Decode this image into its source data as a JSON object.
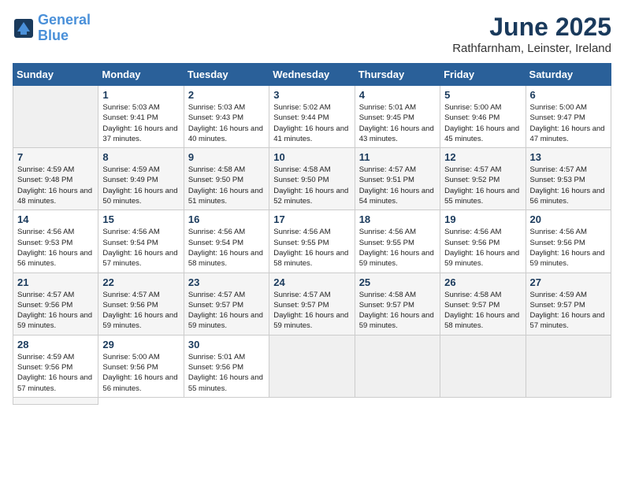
{
  "header": {
    "logo_line1": "General",
    "logo_line2": "Blue",
    "month_title": "June 2025",
    "location": "Rathfarnham, Leinster, Ireland"
  },
  "weekdays": [
    "Sunday",
    "Monday",
    "Tuesday",
    "Wednesday",
    "Thursday",
    "Friday",
    "Saturday"
  ],
  "days": [
    {
      "num": "",
      "empty": true
    },
    {
      "num": "1",
      "sunrise": "5:03 AM",
      "sunset": "9:41 PM",
      "daylight": "16 hours and 37 minutes."
    },
    {
      "num": "2",
      "sunrise": "5:03 AM",
      "sunset": "9:43 PM",
      "daylight": "16 hours and 40 minutes."
    },
    {
      "num": "3",
      "sunrise": "5:02 AM",
      "sunset": "9:44 PM",
      "daylight": "16 hours and 41 minutes."
    },
    {
      "num": "4",
      "sunrise": "5:01 AM",
      "sunset": "9:45 PM",
      "daylight": "16 hours and 43 minutes."
    },
    {
      "num": "5",
      "sunrise": "5:00 AM",
      "sunset": "9:46 PM",
      "daylight": "16 hours and 45 minutes."
    },
    {
      "num": "6",
      "sunrise": "5:00 AM",
      "sunset": "9:47 PM",
      "daylight": "16 hours and 47 minutes."
    },
    {
      "num": "7",
      "sunrise": "4:59 AM",
      "sunset": "9:48 PM",
      "daylight": "16 hours and 48 minutes."
    },
    {
      "num": "8",
      "sunrise": "4:59 AM",
      "sunset": "9:49 PM",
      "daylight": "16 hours and 50 minutes."
    },
    {
      "num": "9",
      "sunrise": "4:58 AM",
      "sunset": "9:50 PM",
      "daylight": "16 hours and 51 minutes."
    },
    {
      "num": "10",
      "sunrise": "4:58 AM",
      "sunset": "9:50 PM",
      "daylight": "16 hours and 52 minutes."
    },
    {
      "num": "11",
      "sunrise": "4:57 AM",
      "sunset": "9:51 PM",
      "daylight": "16 hours and 54 minutes."
    },
    {
      "num": "12",
      "sunrise": "4:57 AM",
      "sunset": "9:52 PM",
      "daylight": "16 hours and 55 minutes."
    },
    {
      "num": "13",
      "sunrise": "4:57 AM",
      "sunset": "9:53 PM",
      "daylight": "16 hours and 56 minutes."
    },
    {
      "num": "14",
      "sunrise": "4:56 AM",
      "sunset": "9:53 PM",
      "daylight": "16 hours and 56 minutes."
    },
    {
      "num": "15",
      "sunrise": "4:56 AM",
      "sunset": "9:54 PM",
      "daylight": "16 hours and 57 minutes."
    },
    {
      "num": "16",
      "sunrise": "4:56 AM",
      "sunset": "9:54 PM",
      "daylight": "16 hours and 58 minutes."
    },
    {
      "num": "17",
      "sunrise": "4:56 AM",
      "sunset": "9:55 PM",
      "daylight": "16 hours and 58 minutes."
    },
    {
      "num": "18",
      "sunrise": "4:56 AM",
      "sunset": "9:55 PM",
      "daylight": "16 hours and 59 minutes."
    },
    {
      "num": "19",
      "sunrise": "4:56 AM",
      "sunset": "9:56 PM",
      "daylight": "16 hours and 59 minutes."
    },
    {
      "num": "20",
      "sunrise": "4:56 AM",
      "sunset": "9:56 PM",
      "daylight": "16 hours and 59 minutes."
    },
    {
      "num": "21",
      "sunrise": "4:57 AM",
      "sunset": "9:56 PM",
      "daylight": "16 hours and 59 minutes."
    },
    {
      "num": "22",
      "sunrise": "4:57 AM",
      "sunset": "9:56 PM",
      "daylight": "16 hours and 59 minutes."
    },
    {
      "num": "23",
      "sunrise": "4:57 AM",
      "sunset": "9:57 PM",
      "daylight": "16 hours and 59 minutes."
    },
    {
      "num": "24",
      "sunrise": "4:57 AM",
      "sunset": "9:57 PM",
      "daylight": "16 hours and 59 minutes."
    },
    {
      "num": "25",
      "sunrise": "4:58 AM",
      "sunset": "9:57 PM",
      "daylight": "16 hours and 59 minutes."
    },
    {
      "num": "26",
      "sunrise": "4:58 AM",
      "sunset": "9:57 PM",
      "daylight": "16 hours and 58 minutes."
    },
    {
      "num": "27",
      "sunrise": "4:59 AM",
      "sunset": "9:57 PM",
      "daylight": "16 hours and 57 minutes."
    },
    {
      "num": "28",
      "sunrise": "4:59 AM",
      "sunset": "9:56 PM",
      "daylight": "16 hours and 57 minutes."
    },
    {
      "num": "29",
      "sunrise": "5:00 AM",
      "sunset": "9:56 PM",
      "daylight": "16 hours and 56 minutes."
    },
    {
      "num": "30",
      "sunrise": "5:01 AM",
      "sunset": "9:56 PM",
      "daylight": "16 hours and 55 minutes."
    },
    {
      "num": "",
      "empty": true
    },
    {
      "num": "",
      "empty": true
    },
    {
      "num": "",
      "empty": true
    },
    {
      "num": "",
      "empty": true
    },
    {
      "num": "",
      "empty": true
    }
  ]
}
